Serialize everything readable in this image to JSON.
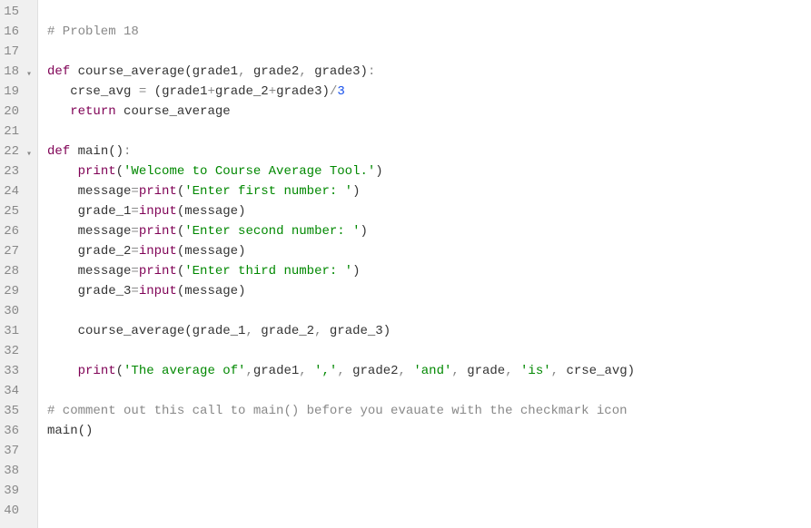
{
  "editor": {
    "lines": [
      {
        "num": 15,
        "fold": false,
        "tokens": []
      },
      {
        "num": 16,
        "fold": false,
        "tokens": [
          {
            "cls": "tok-comment",
            "text": "# Problem 18"
          }
        ]
      },
      {
        "num": 17,
        "fold": false,
        "tokens": []
      },
      {
        "num": 18,
        "fold": true,
        "tokens": [
          {
            "cls": "tok-keyword",
            "text": "def"
          },
          {
            "cls": "tok-plain",
            "text": " "
          },
          {
            "cls": "tok-funcname",
            "text": "course_average"
          },
          {
            "cls": "tok-paren",
            "text": "("
          },
          {
            "cls": "tok-var",
            "text": "grade1"
          },
          {
            "cls": "tok-op",
            "text": ", "
          },
          {
            "cls": "tok-var",
            "text": "grade2"
          },
          {
            "cls": "tok-op",
            "text": ", "
          },
          {
            "cls": "tok-var",
            "text": "grade3"
          },
          {
            "cls": "tok-paren",
            "text": ")"
          },
          {
            "cls": "tok-op",
            "text": ":"
          }
        ]
      },
      {
        "num": 19,
        "fold": false,
        "tokens": [
          {
            "cls": "tok-plain",
            "text": "   "
          },
          {
            "cls": "tok-var",
            "text": "crse_avg"
          },
          {
            "cls": "tok-plain",
            "text": " "
          },
          {
            "cls": "tok-op",
            "text": "="
          },
          {
            "cls": "tok-plain",
            "text": " "
          },
          {
            "cls": "tok-paren",
            "text": "("
          },
          {
            "cls": "tok-var",
            "text": "grade1"
          },
          {
            "cls": "tok-op",
            "text": "+"
          },
          {
            "cls": "tok-var",
            "text": "grade_2"
          },
          {
            "cls": "tok-op",
            "text": "+"
          },
          {
            "cls": "tok-var",
            "text": "grade3"
          },
          {
            "cls": "tok-paren",
            "text": ")"
          },
          {
            "cls": "tok-op",
            "text": "/"
          },
          {
            "cls": "tok-num",
            "text": "3"
          }
        ]
      },
      {
        "num": 20,
        "fold": false,
        "tokens": [
          {
            "cls": "tok-plain",
            "text": "   "
          },
          {
            "cls": "tok-keyword",
            "text": "return"
          },
          {
            "cls": "tok-plain",
            "text": " "
          },
          {
            "cls": "tok-var",
            "text": "course_average"
          }
        ]
      },
      {
        "num": 21,
        "fold": false,
        "tokens": []
      },
      {
        "num": 22,
        "fold": true,
        "tokens": [
          {
            "cls": "tok-keyword",
            "text": "def"
          },
          {
            "cls": "tok-plain",
            "text": " "
          },
          {
            "cls": "tok-funcname",
            "text": "main"
          },
          {
            "cls": "tok-paren",
            "text": "()"
          },
          {
            "cls": "tok-op",
            "text": ":"
          }
        ]
      },
      {
        "num": 23,
        "fold": false,
        "tokens": [
          {
            "cls": "tok-plain",
            "text": "    "
          },
          {
            "cls": "tok-builtin",
            "text": "print"
          },
          {
            "cls": "tok-paren",
            "text": "("
          },
          {
            "cls": "tok-string",
            "text": "'Welcome to Course Average Tool.'"
          },
          {
            "cls": "tok-paren",
            "text": ")"
          }
        ]
      },
      {
        "num": 24,
        "fold": false,
        "tokens": [
          {
            "cls": "tok-plain",
            "text": "    "
          },
          {
            "cls": "tok-var",
            "text": "message"
          },
          {
            "cls": "tok-op",
            "text": "="
          },
          {
            "cls": "tok-builtin",
            "text": "print"
          },
          {
            "cls": "tok-paren",
            "text": "("
          },
          {
            "cls": "tok-string",
            "text": "'Enter first number: '"
          },
          {
            "cls": "tok-paren",
            "text": ")"
          }
        ]
      },
      {
        "num": 25,
        "fold": false,
        "tokens": [
          {
            "cls": "tok-plain",
            "text": "    "
          },
          {
            "cls": "tok-var",
            "text": "grade_1"
          },
          {
            "cls": "tok-op",
            "text": "="
          },
          {
            "cls": "tok-builtin",
            "text": "input"
          },
          {
            "cls": "tok-paren",
            "text": "("
          },
          {
            "cls": "tok-var",
            "text": "message"
          },
          {
            "cls": "tok-paren",
            "text": ")"
          }
        ]
      },
      {
        "num": 26,
        "fold": false,
        "tokens": [
          {
            "cls": "tok-plain",
            "text": "    "
          },
          {
            "cls": "tok-var",
            "text": "message"
          },
          {
            "cls": "tok-op",
            "text": "="
          },
          {
            "cls": "tok-builtin",
            "text": "print"
          },
          {
            "cls": "tok-paren",
            "text": "("
          },
          {
            "cls": "tok-string",
            "text": "'Enter second number: '"
          },
          {
            "cls": "tok-paren",
            "text": ")"
          }
        ]
      },
      {
        "num": 27,
        "fold": false,
        "tokens": [
          {
            "cls": "tok-plain",
            "text": "    "
          },
          {
            "cls": "tok-var",
            "text": "grade_2"
          },
          {
            "cls": "tok-op",
            "text": "="
          },
          {
            "cls": "tok-builtin",
            "text": "input"
          },
          {
            "cls": "tok-paren",
            "text": "("
          },
          {
            "cls": "tok-var",
            "text": "message"
          },
          {
            "cls": "tok-paren",
            "text": ")"
          }
        ]
      },
      {
        "num": 28,
        "fold": false,
        "tokens": [
          {
            "cls": "tok-plain",
            "text": "    "
          },
          {
            "cls": "tok-var",
            "text": "message"
          },
          {
            "cls": "tok-op",
            "text": "="
          },
          {
            "cls": "tok-builtin",
            "text": "print"
          },
          {
            "cls": "tok-paren",
            "text": "("
          },
          {
            "cls": "tok-string",
            "text": "'Enter third number: '"
          },
          {
            "cls": "tok-paren",
            "text": ")"
          }
        ]
      },
      {
        "num": 29,
        "fold": false,
        "tokens": [
          {
            "cls": "tok-plain",
            "text": "    "
          },
          {
            "cls": "tok-var",
            "text": "grade_3"
          },
          {
            "cls": "tok-op",
            "text": "="
          },
          {
            "cls": "tok-builtin",
            "text": "input"
          },
          {
            "cls": "tok-paren",
            "text": "("
          },
          {
            "cls": "tok-var",
            "text": "message"
          },
          {
            "cls": "tok-paren",
            "text": ")"
          }
        ]
      },
      {
        "num": 30,
        "fold": false,
        "tokens": []
      },
      {
        "num": 31,
        "fold": false,
        "tokens": [
          {
            "cls": "tok-plain",
            "text": "    "
          },
          {
            "cls": "tok-funcname",
            "text": "course_average"
          },
          {
            "cls": "tok-paren",
            "text": "("
          },
          {
            "cls": "tok-var",
            "text": "grade_1"
          },
          {
            "cls": "tok-op",
            "text": ", "
          },
          {
            "cls": "tok-var",
            "text": "grade_2"
          },
          {
            "cls": "tok-op",
            "text": ", "
          },
          {
            "cls": "tok-var",
            "text": "grade_3"
          },
          {
            "cls": "tok-paren",
            "text": ")"
          }
        ]
      },
      {
        "num": 32,
        "fold": false,
        "tokens": []
      },
      {
        "num": 33,
        "fold": false,
        "tokens": [
          {
            "cls": "tok-plain",
            "text": "    "
          },
          {
            "cls": "tok-builtin",
            "text": "print"
          },
          {
            "cls": "tok-paren",
            "text": "("
          },
          {
            "cls": "tok-string",
            "text": "'The average of'"
          },
          {
            "cls": "tok-op",
            "text": ","
          },
          {
            "cls": "tok-var",
            "text": "grade1"
          },
          {
            "cls": "tok-op",
            "text": ", "
          },
          {
            "cls": "tok-string",
            "text": "','"
          },
          {
            "cls": "tok-op",
            "text": ", "
          },
          {
            "cls": "tok-var",
            "text": "grade2"
          },
          {
            "cls": "tok-op",
            "text": ", "
          },
          {
            "cls": "tok-string",
            "text": "'and'"
          },
          {
            "cls": "tok-op",
            "text": ", "
          },
          {
            "cls": "tok-var",
            "text": "grade"
          },
          {
            "cls": "tok-op",
            "text": ", "
          },
          {
            "cls": "tok-string",
            "text": "'is'"
          },
          {
            "cls": "tok-op",
            "text": ", "
          },
          {
            "cls": "tok-var",
            "text": "crse_avg"
          },
          {
            "cls": "tok-paren",
            "text": ")"
          }
        ]
      },
      {
        "num": 34,
        "fold": false,
        "tokens": []
      },
      {
        "num": 35,
        "fold": false,
        "tokens": [
          {
            "cls": "tok-comment",
            "text": "# comment out this call to main() before you evauate with the checkmark icon"
          }
        ]
      },
      {
        "num": 36,
        "fold": false,
        "tokens": [
          {
            "cls": "tok-funcname",
            "text": "main"
          },
          {
            "cls": "tok-paren",
            "text": "()"
          }
        ]
      },
      {
        "num": 37,
        "fold": false,
        "tokens": []
      },
      {
        "num": 38,
        "fold": false,
        "tokens": []
      },
      {
        "num": 39,
        "fold": false,
        "tokens": []
      },
      {
        "num": 40,
        "fold": false,
        "tokens": []
      }
    ],
    "fold_glyph": "▾"
  }
}
